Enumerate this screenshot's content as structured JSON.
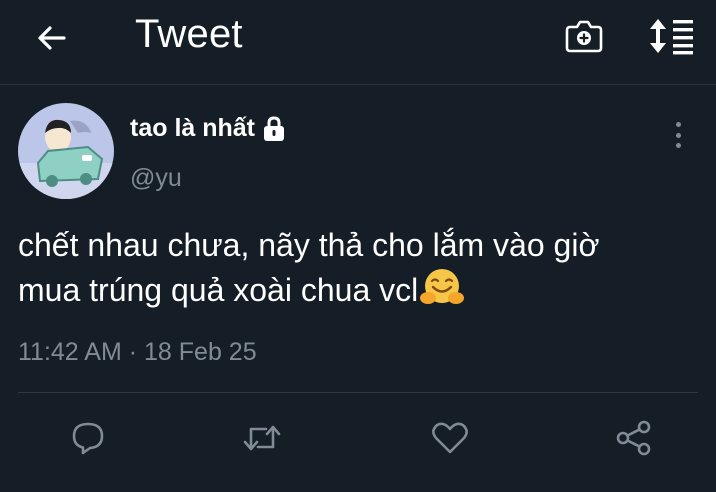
{
  "header": {
    "title": "Tweet",
    "back_icon": "arrow-left-icon",
    "camera_icon": "camera-icon",
    "sort_icon": "sort-list-icon"
  },
  "tweet": {
    "display_name": "tao là nhất",
    "handle": "@yu",
    "protected_icon": "lock-icon",
    "text_line1": "chết nhau chưa, nãy thả cho lắm vào giờ",
    "text_line2": "mua trúng quả xoài chua vcl",
    "emoji": "hugging-face-emoji",
    "time": "11:42 AM",
    "separator": "·",
    "date": "18 Feb 25"
  },
  "actions": [
    {
      "icon": "reply-icon"
    },
    {
      "icon": "retweet-icon"
    },
    {
      "icon": "like-icon"
    },
    {
      "icon": "share-icon"
    }
  ],
  "colors": {
    "background": "#151d26",
    "text_primary": "#ffffff",
    "text_secondary": "#7f8b97",
    "divider": "#2b3846"
  }
}
